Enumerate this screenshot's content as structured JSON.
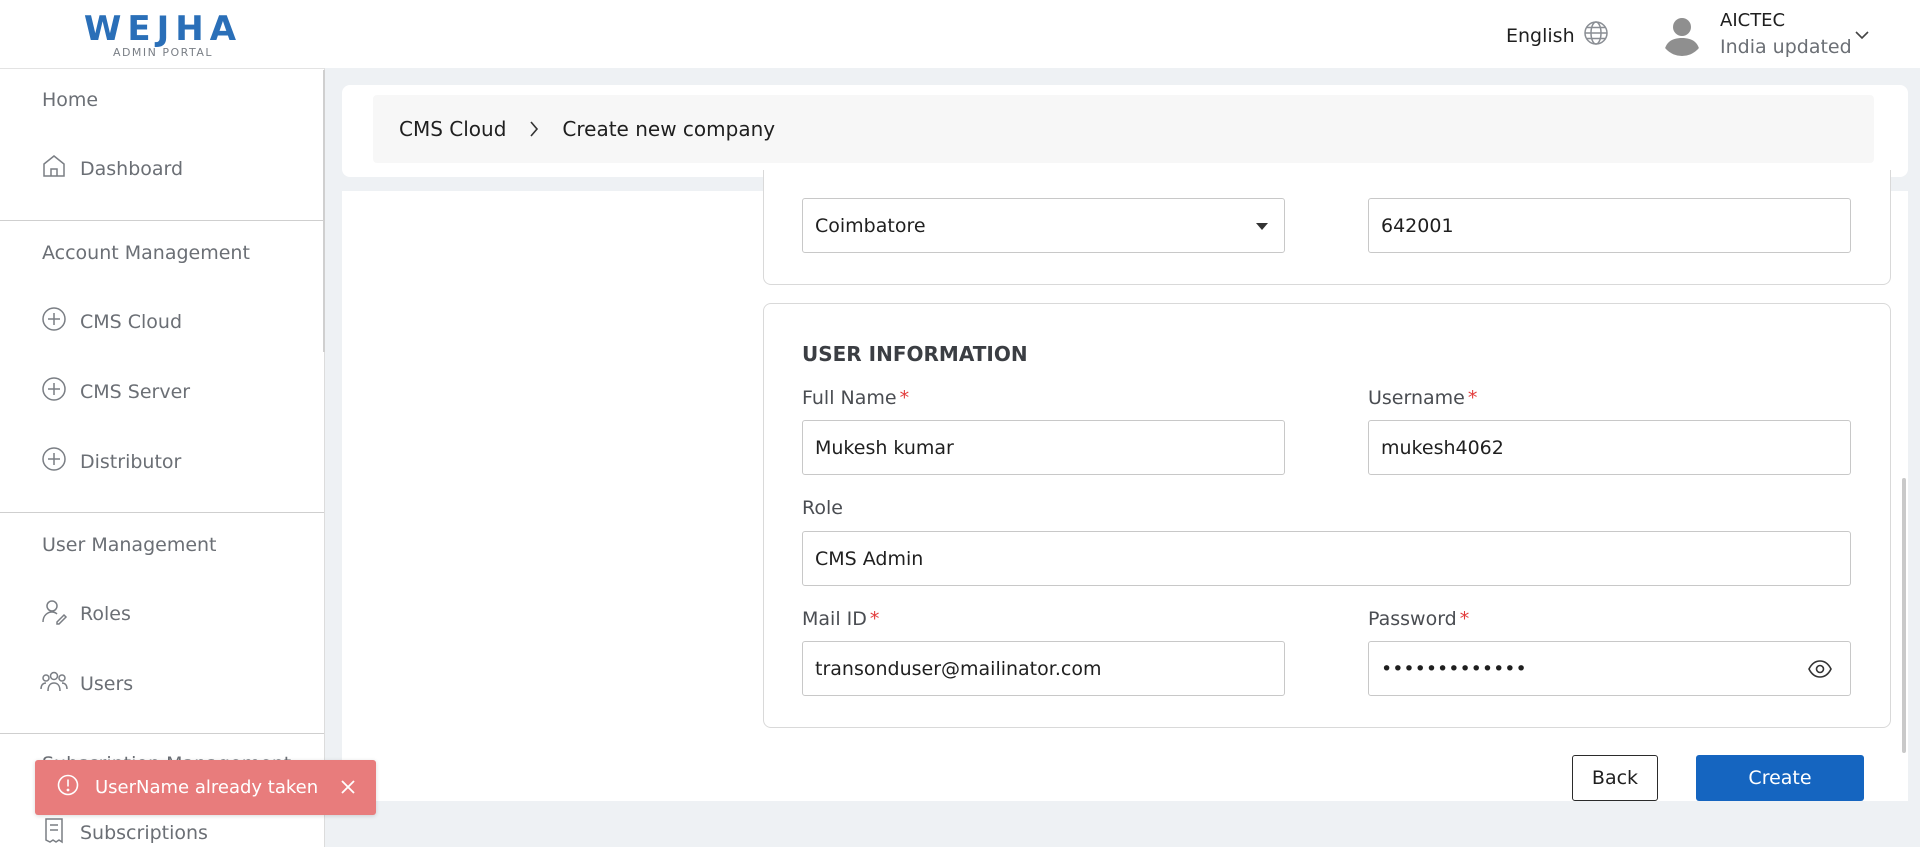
{
  "header": {
    "logo_text": "WEJHA",
    "logo_subtitle": "ADMIN PORTAL",
    "language": "English",
    "user_name": "AICTEC",
    "user_org": "India updated"
  },
  "sidebar": {
    "sections": [
      {
        "title": "Home",
        "items": [
          {
            "label": "Dashboard",
            "icon": "home-icon"
          }
        ]
      },
      {
        "title": "Account Management",
        "items": [
          {
            "label": "CMS Cloud",
            "icon": "plus-circle-icon"
          },
          {
            "label": "CMS Server",
            "icon": "plus-circle-icon"
          },
          {
            "label": "Distributor",
            "icon": "plus-circle-icon"
          }
        ]
      },
      {
        "title": "User Management",
        "items": [
          {
            "label": "Roles",
            "icon": "user-edit-icon"
          },
          {
            "label": "Users",
            "icon": "users-icon"
          }
        ]
      },
      {
        "title": "Subscription Management",
        "items": [
          {
            "label": "Subscriptions",
            "icon": "receipt-icon"
          }
        ]
      }
    ]
  },
  "breadcrumb": {
    "parent": "CMS Cloud",
    "current": "Create new company"
  },
  "address": {
    "city_value": "Coimbatore",
    "pincode_value": "642001"
  },
  "user_info": {
    "title": "USER INFORMATION",
    "full_name_label": "Full Name",
    "full_name_value": "Mukesh kumar",
    "username_label": "Username",
    "username_value": "mukesh4062",
    "role_label": "Role",
    "role_value": "CMS Admin",
    "mail_label": "Mail ID",
    "mail_value": "transonduser@mailinator.com",
    "password_label": "Password",
    "password_value": "•••••••••••••",
    "required_mark": "*"
  },
  "actions": {
    "back_label": "Back",
    "create_label": "Create"
  },
  "toast": {
    "message": "UserName already taken"
  },
  "colors": {
    "primary": "#1565c0",
    "logo": "#2a6fb8",
    "toast_bg": "#e87c7c",
    "required": "#e23b3b"
  }
}
